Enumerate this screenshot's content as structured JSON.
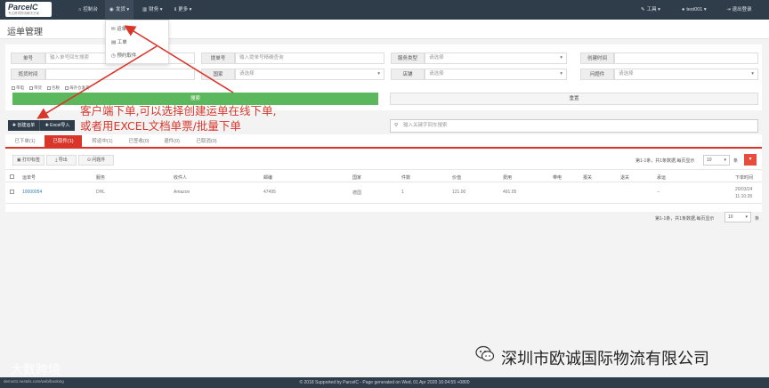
{
  "topbar": {
    "logo_text": "ParcelC",
    "logo_sub": "专注跨境物流解决方案",
    "nav": [
      {
        "icon": "home-icon",
        "glyph": "⌂",
        "label": "控制台"
      },
      {
        "icon": "globe-icon",
        "glyph": "◉",
        "label": "发货 ▾"
      },
      {
        "icon": "chart-icon",
        "glyph": "▥",
        "label": "财务 ▾"
      },
      {
        "icon": "info-icon",
        "glyph": "ℹ",
        "label": "更多 ▾"
      }
    ],
    "right": [
      {
        "icon": "wrench-icon",
        "glyph": "✎",
        "label": "工具 ▾"
      },
      {
        "icon": "user-icon",
        "glyph": "●",
        "label": "test001 ▾"
      },
      {
        "icon": "logout-icon",
        "glyph": "⇥",
        "label": "退出登录"
      }
    ]
  },
  "dropdown": [
    {
      "icon": "mail-icon",
      "glyph": "✉",
      "label": "运单"
    },
    {
      "icon": "doc-icon",
      "glyph": "▤",
      "label": "工单"
    },
    {
      "icon": "clock-icon",
      "glyph": "◷",
      "label": "预约取件"
    }
  ],
  "page_title": "运单管理",
  "filters": {
    "order_no_label": "单号",
    "order_no_placeholder": "输入单号回车搜索",
    "bill_no_label": "提单号",
    "bill_no_placeholder": "输入提单号精确查询",
    "service_type_label": "服务类型",
    "service_type_value": "请选择",
    "created_time_label": "创建时间",
    "pick_time_label": "揽货时间",
    "country_label": "国家",
    "country_value": "请选择",
    "store_label": "店铺",
    "store_value": "请选择",
    "issue_label": "问题件",
    "issue_value": "请选择",
    "checkboxes": [
      "带电",
      "带货",
      "包税",
      "海外仓发货"
    ],
    "search_button": "搜索",
    "reset_button": "重置"
  },
  "actions": {
    "create_button": "✚ 创建运单",
    "excel_button": "✚ Excel导入",
    "keyword_placeholder": "输入关键字回车搜索"
  },
  "tabs": [
    "已下单(1)",
    "已取件(1)",
    "转运中(1)",
    "已签收(0)",
    "退件(0)",
    "已取消(0)"
  ],
  "toolbar": {
    "print_button": "打印标签",
    "export_button": "导出",
    "issue_button": "问题件",
    "page_info": "第1-1条，共1条数据,每页显示",
    "per_page": "10",
    "per_page_suffix": "条"
  },
  "table": {
    "headers": [
      "运单号",
      "服务",
      "收件人",
      "邮编",
      "国家",
      "件数",
      "价值",
      "费用",
      "带电",
      "报关",
      "退关",
      "承运",
      "下单时间"
    ],
    "rows": [
      {
        "order_no": "10000054",
        "service": "DHL",
        "recipient": "Amazon",
        "zip": "47495",
        "country": "德国",
        "pieces": "1",
        "value": "121.00",
        "fee": "491.05",
        "carrier": "--",
        "date": "20/03/24",
        "time": "11:10:28"
      }
    ]
  },
  "bottom_pager": {
    "page_info": "第1-1条，共1条数据,每页显示",
    "per_page": "10",
    "per_page_suffix": "条"
  },
  "annotation": {
    "line1": "客户端下单,可以选择创建运单在线下单,",
    "line2": "或者用EXCEL文档单票/批量下单"
  },
  "footer": "© 2018 Supported by ParcelC - Page generated on Wed, 01 Apr 2020 16:04:55 +0800",
  "watermark": {
    "left": "大数跨境",
    "right": "深圳市欧诚国际物流有限公司",
    "url": "demo01.nestxls.com/web/booking"
  },
  "colors": {
    "topbar": "#2f3c4a",
    "accent_red": "#d9362b",
    "search_green": "#5cb85c",
    "link_blue": "#337ab7"
  }
}
